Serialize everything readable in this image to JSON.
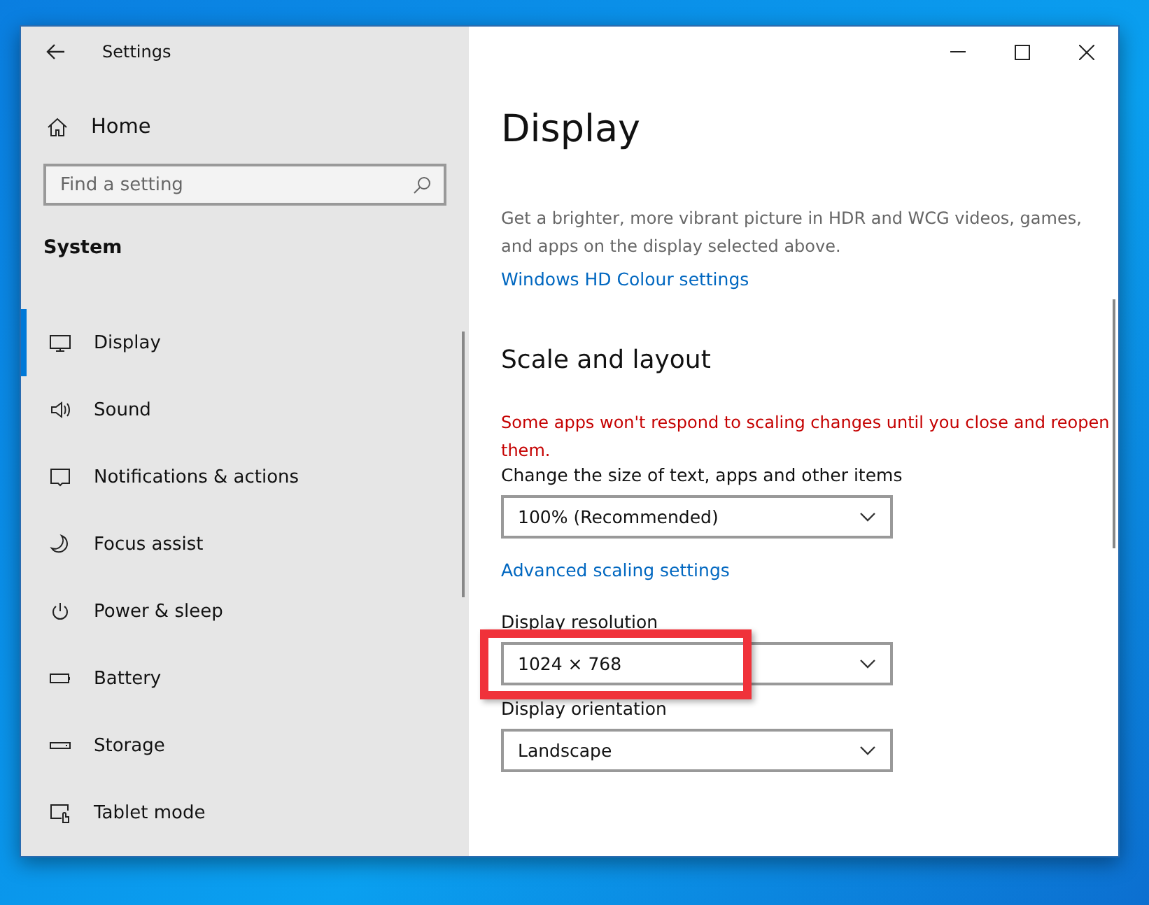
{
  "window": {
    "title": "Settings"
  },
  "sidebar": {
    "home": "Home",
    "search": {
      "placeholder": "Find a setting"
    },
    "section": "System",
    "items": [
      {
        "label": "Display",
        "selected": true
      },
      {
        "label": "Sound",
        "selected": false
      },
      {
        "label": "Notifications & actions",
        "selected": false
      },
      {
        "label": "Focus assist",
        "selected": false
      },
      {
        "label": "Power & sleep",
        "selected": false
      },
      {
        "label": "Battery",
        "selected": false
      },
      {
        "label": "Storage",
        "selected": false
      },
      {
        "label": "Tablet mode",
        "selected": false
      }
    ]
  },
  "content": {
    "title": "Display",
    "hdr_description": "Get a brighter, more vibrant picture in HDR and WCG videos, games, and apps on the display selected above.",
    "hdr_link": "Windows HD Colour settings",
    "section": "Scale and layout",
    "warning": "Some apps won't respond to scaling changes until you close and reopen them.",
    "fields": [
      {
        "kind": "dropdown",
        "label": "Change the size of text, apps and other items",
        "value": "100% (Recommended)",
        "highlighted": false
      },
      {
        "kind": "link",
        "label": "Advanced scaling settings"
      },
      {
        "kind": "dropdown",
        "label": "Display resolution",
        "value": "1024 × 768",
        "highlighted": true
      },
      {
        "kind": "dropdown",
        "label": "Display orientation",
        "value": "Landscape",
        "highlighted": false
      }
    ]
  }
}
